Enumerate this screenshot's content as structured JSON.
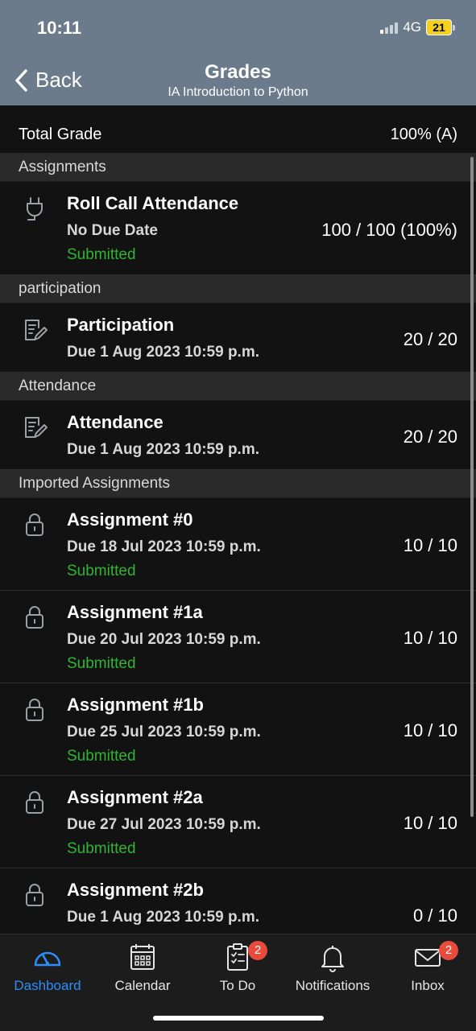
{
  "status_bar": {
    "time": "10:11",
    "network": "4G",
    "battery": "21"
  },
  "nav": {
    "back_label": "Back",
    "title": "Grades",
    "subtitle": "IA Introduction to Python"
  },
  "total": {
    "label": "Total Grade",
    "value": "100% (A)"
  },
  "sections": [
    {
      "label": "Assignments"
    },
    {
      "label": "participation"
    },
    {
      "label": "Attendance"
    },
    {
      "label": "Imported Assignments"
    }
  ],
  "items": [
    {
      "name": "Roll Call Attendance",
      "due": "No Due Date",
      "status": "Submitted",
      "score": "100 / 100 (100%)",
      "icon": "plug-icon"
    },
    {
      "name": "Participation",
      "due": "Due 1 Aug 2023 10:59 p.m.",
      "score": "20 / 20",
      "icon": "edit-document-icon"
    },
    {
      "name": "Attendance",
      "due": "Due 1 Aug 2023 10:59 p.m.",
      "score": "20 / 20",
      "icon": "edit-document-icon"
    },
    {
      "name": "Assignment #0",
      "due": "Due 18 Jul 2023 10:59 p.m.",
      "status": "Submitted",
      "score": "10 / 10",
      "icon": "lock-icon"
    },
    {
      "name": "Assignment #1a",
      "due": "Due 20 Jul 2023 10:59 p.m.",
      "status": "Submitted",
      "score": "10 / 10",
      "icon": "lock-icon"
    },
    {
      "name": "Assignment #1b",
      "due": "Due 25 Jul 2023 10:59 p.m.",
      "status": "Submitted",
      "score": "10 / 10",
      "icon": "lock-icon"
    },
    {
      "name": "Assignment #2a",
      "due": "Due 27 Jul 2023 10:59 p.m.",
      "status": "Submitted",
      "score": "10 / 10",
      "icon": "lock-icon"
    },
    {
      "name": "Assignment #2b",
      "due": "Due 1 Aug 2023 10:59 p.m.",
      "score": "0 / 10",
      "icon": "lock-icon"
    }
  ],
  "tabs": [
    {
      "label": "Dashboard",
      "icon": "dashboard-icon",
      "active": true
    },
    {
      "label": "Calendar",
      "icon": "calendar-icon"
    },
    {
      "label": "To Do",
      "icon": "todo-icon",
      "badge": "2"
    },
    {
      "label": "Notifications",
      "icon": "bell-icon"
    },
    {
      "label": "Inbox",
      "icon": "inbox-icon",
      "badge": "2"
    }
  ],
  "colors": {
    "header": "#6b7b8c",
    "submitted": "#2fb52f",
    "active_tab": "#2c8ef8",
    "badge": "#e84a3c"
  }
}
